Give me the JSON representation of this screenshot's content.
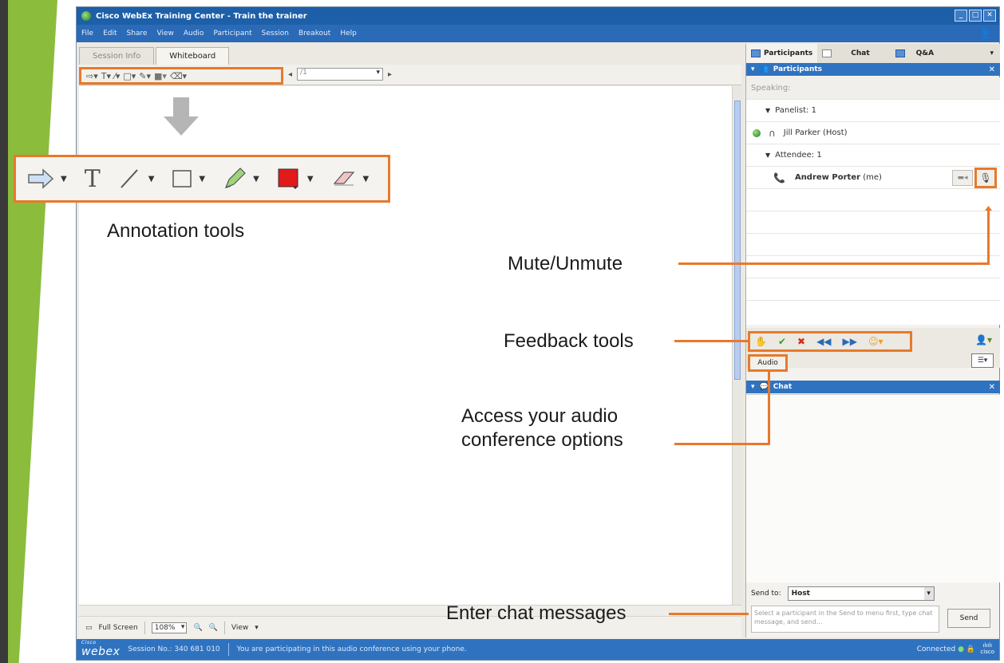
{
  "window": {
    "title": "Cisco WebEx Training Center - Train the trainer",
    "menu": [
      "File",
      "Edit",
      "Share",
      "View",
      "Audio",
      "Participant",
      "Session",
      "Breakout",
      "Help"
    ]
  },
  "left_pane": {
    "tabs": [
      {
        "label": "Session Info",
        "active": false
      },
      {
        "label": "Whiteboard",
        "active": true
      }
    ],
    "page_select_value": "/1",
    "status": {
      "full_screen": "Full Screen",
      "zoom": "108%",
      "view": "View"
    }
  },
  "annotation": {
    "label": "Annotation tools",
    "tool_icons": [
      "arrow-icon",
      "text-icon",
      "line-icon",
      "rectangle-icon",
      "highlighter-icon",
      "color-icon",
      "eraser-icon"
    ],
    "text_glyph": "T",
    "accent_color": "#e8792b",
    "color_swatch": "#e11a1a"
  },
  "right_pane": {
    "tabs": [
      {
        "label": "Participants",
        "active": true
      },
      {
        "label": "Chat",
        "active": false
      },
      {
        "label": "Q&A",
        "active": false
      }
    ],
    "participants_header": "Participants",
    "speaking": "Speaking:",
    "groups": [
      {
        "label": "Panelist: 1"
      },
      {
        "label": "Attendee: 1"
      }
    ],
    "panelist_name": "Jill Parker (Host)",
    "attendee_name": "Andrew Porter",
    "attendee_suffix": "(me)",
    "audio_button": "Audio",
    "chat_header": "Chat",
    "send_to_label": "Send to:",
    "send_to_value": "Host",
    "chat_placeholder": "Select a participant in the Send to menu first, type chat message, and send...",
    "send_button": "Send"
  },
  "statusbar": {
    "logo_small": "Cisco",
    "logo": "webex",
    "session": "Session No.: 340 681 010",
    "message": "You are participating in this audio conference using your phone.",
    "connected": "Connected",
    "cisco_label": "cisco"
  },
  "callouts": {
    "mute": "Mute/Unmute",
    "feedback": "Feedback tools",
    "audio_line1": "Access your audio",
    "audio_line2": "conference options",
    "chat": "Enter chat messages"
  }
}
